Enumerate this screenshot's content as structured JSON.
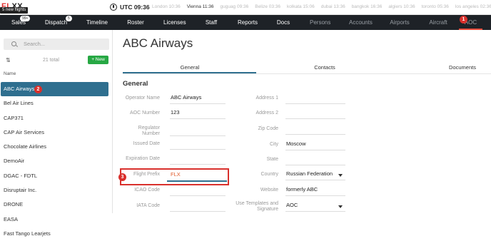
{
  "brand": {
    "logo_prefix": "FL",
    "logo_rest": "XX",
    "new_flights": "5 new flights"
  },
  "clock": {
    "utc": "UTC 09:36"
  },
  "timezones": [
    {
      "label": "London 10:36",
      "hl": false
    },
    {
      "label": "Vienna 11:36",
      "hl": true
    },
    {
      "label": "guguag 09:36",
      "hl": false
    },
    {
      "label": "Belize 03:36",
      "hl": false
    },
    {
      "label": "kolkata 15:06",
      "hl": false
    },
    {
      "label": "dubai 13:36",
      "hl": false
    },
    {
      "label": "bangkok 16:36",
      "hl": false
    },
    {
      "label": "algiers 10:36",
      "hl": false
    },
    {
      "label": "toronto 05:36",
      "hl": false
    },
    {
      "label": "los angeles 02:36",
      "hl": false
    }
  ],
  "nav": {
    "sales": "Sales",
    "sales_badge": "99+",
    "dispatch": "Dispatch",
    "dispatch_badge": "5",
    "timeline": "Timeline",
    "roster": "Roster",
    "licenses": "Licenses",
    "staff": "Staff",
    "reports": "Reports",
    "docs": "Docs",
    "persons": "Persons",
    "accounts": "Accounts",
    "airports": "Airports",
    "aircraft": "Aircraft",
    "aoc": "AOC"
  },
  "annotations": {
    "one": "1",
    "two": "2",
    "three": "3"
  },
  "sidebar": {
    "search_placeholder": "Search...",
    "sort_icon": "sort-icon",
    "total": "21 total",
    "new_button": "+ New",
    "column_header": "Name",
    "items": [
      "ABC Airways",
      "Bel Air Lines",
      "CAP371",
      "CAP Air Services",
      "Chocolate Airlines",
      "DemoAir",
      "DGAC - FDTL",
      "Disruptair Inc.",
      "DRONE",
      "EASA",
      "Fast Tango Learjets"
    ]
  },
  "main": {
    "title": "ABC Airways",
    "tabs": {
      "general": "General",
      "contacts": "Contacts",
      "documents": "Documents"
    },
    "section": "General",
    "left_fields": {
      "operator_name": {
        "label": "Operator Name",
        "value": "ABC Airways"
      },
      "aoc_number": {
        "label": "AOC Number",
        "value": "123"
      },
      "regulator_number": {
        "label": "Regulator Number",
        "value": ""
      },
      "issued_date": {
        "label": "Issued Date",
        "value": ""
      },
      "expiration_date": {
        "label": "Expiration Date",
        "value": ""
      },
      "flight_prefix": {
        "label": "Flight Prefix",
        "value": "FLX"
      },
      "icao_code": {
        "label": "ICAO Code",
        "value": ""
      },
      "iata_code": {
        "label": "IATA Code",
        "value": ""
      }
    },
    "right_fields": {
      "address1": {
        "label": "Address 1",
        "value": ""
      },
      "address2": {
        "label": "Address 2",
        "value": ""
      },
      "zip": {
        "label": "Zip Code",
        "value": ""
      },
      "city": {
        "label": "City",
        "value": "Moscow"
      },
      "state": {
        "label": "State",
        "value": ""
      },
      "country": {
        "label": "Country",
        "value": "Russian Federation"
      },
      "website": {
        "label": "Website",
        "value": "formerly ABC"
      },
      "templates": {
        "label": "Use Templates and Signature",
        "value": "AOC"
      }
    }
  }
}
